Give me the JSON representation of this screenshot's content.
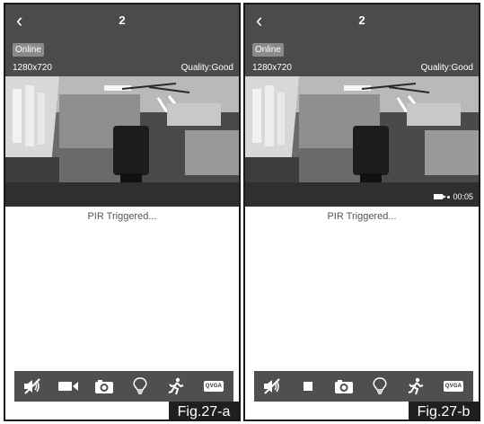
{
  "panels": [
    {
      "title": "2",
      "status_badge": "Online",
      "resolution": "1280x720",
      "quality": "Quality:Good",
      "video_overlay_text": "",
      "recording_time": "",
      "pir_message": "PIR Triggered...",
      "toolbar_icons": [
        "mute-icon",
        "record-video-icon",
        "snapshot-icon",
        "light-bulb-icon",
        "motion-person-icon",
        "qvga-icon"
      ],
      "qvga_label": "QVGA",
      "figure_label": "Fig.27-a"
    },
    {
      "title": "2",
      "status_badge": "Online",
      "resolution": "1280x720",
      "quality": "Quality:Good",
      "recording_time": "00:05",
      "pir_message": "PIR Triggered...",
      "toolbar_icons": [
        "mute-icon",
        "stop-icon",
        "snapshot-icon",
        "light-bulb-icon",
        "motion-person-icon",
        "qvga-icon"
      ],
      "qvga_label": "QVGA",
      "figure_label": "Fig.27-b"
    }
  ],
  "colors": {
    "bar_background": "#4b4b4b",
    "toolbar_background": "#4f4f4f",
    "figure_label_background": "#1f1f1f"
  }
}
